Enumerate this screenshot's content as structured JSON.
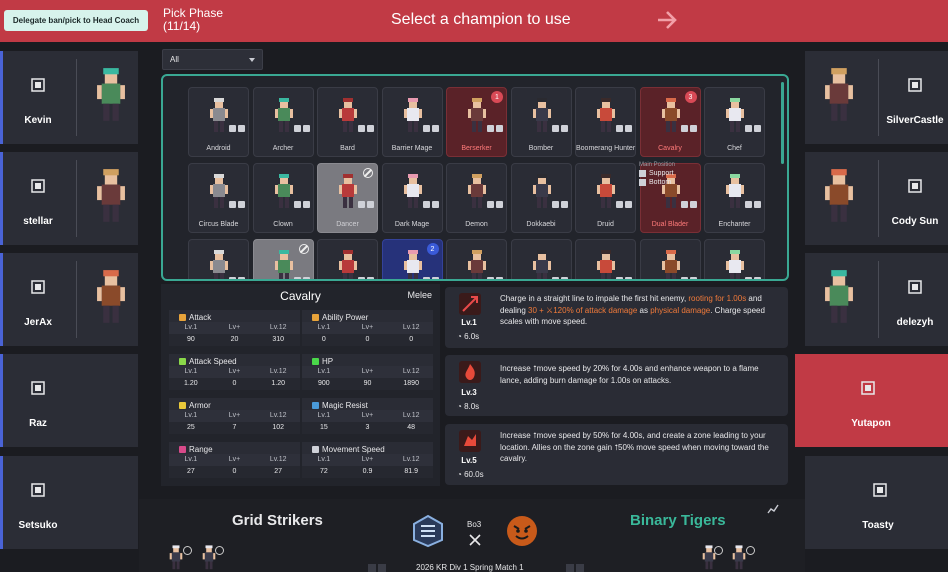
{
  "topbar": {
    "delegate_label": "Delegate ban/pick to Head Coach",
    "phase_title": "Pick Phase",
    "phase_count": "(11/14)",
    "message": "Select a champion to use"
  },
  "left_team": [
    {
      "name": "Kevin",
      "role_icon": "mid-lane-icon"
    },
    {
      "name": "stellar",
      "role_icon": "jungle-icon"
    },
    {
      "name": "JerAx",
      "role_icon": "top-lane-icon"
    },
    {
      "name": "Raz",
      "role_icon": "mid-lane-icon"
    },
    {
      "name": "Setsuko",
      "role_icon": "support-icon"
    }
  ],
  "right_team": [
    {
      "name": "SilverCastle",
      "role_icon": "mid-lane-icon"
    },
    {
      "name": "Cody Sun",
      "role_icon": "jungle-icon"
    },
    {
      "name": "delezyh",
      "role_icon": "top-lane-icon"
    },
    {
      "name": "Yutapon",
      "role_icon": "bottom-lane-icon"
    },
    {
      "name": "Toasty",
      "role_icon": "support-icon"
    }
  ],
  "filter": {
    "selected": "All"
  },
  "champions": [
    {
      "name": "Android",
      "state": "normal"
    },
    {
      "name": "Archer",
      "state": "normal"
    },
    {
      "name": "Bard",
      "state": "normal"
    },
    {
      "name": "Barrier Mage",
      "state": "normal"
    },
    {
      "name": "Berserker",
      "state": "picked",
      "badge": "1"
    },
    {
      "name": "Bomber",
      "state": "normal"
    },
    {
      "name": "Boomerang Hunter",
      "state": "normal"
    },
    {
      "name": "Cavalry",
      "state": "picked",
      "badge": "3"
    },
    {
      "name": "Chef",
      "state": "normal"
    },
    {
      "name": "Circus Blade",
      "state": "normal"
    },
    {
      "name": "Clown",
      "state": "normal"
    },
    {
      "name": "Dancer",
      "state": "banned"
    },
    {
      "name": "Dark Mage",
      "state": "normal"
    },
    {
      "name": "Demon",
      "state": "normal"
    },
    {
      "name": "Dokkaebi",
      "state": "normal"
    },
    {
      "name": "Druid",
      "state": "normal"
    },
    {
      "name": "Dual Blader",
      "state": "picked"
    },
    {
      "name": "Enchanter",
      "state": "normal"
    },
    {
      "name": "",
      "state": "normal"
    },
    {
      "name": "",
      "state": "banned"
    },
    {
      "name": "",
      "state": "normal"
    },
    {
      "name": "",
      "state": "blue-pick",
      "badge": "2"
    },
    {
      "name": "",
      "state": "normal"
    },
    {
      "name": "",
      "state": "normal"
    },
    {
      "name": "",
      "state": "normal"
    },
    {
      "name": "",
      "state": "normal"
    },
    {
      "name": "",
      "state": "normal"
    }
  ],
  "position_popup": {
    "title": "Main Position",
    "options": [
      "Support",
      "Bottom"
    ]
  },
  "stats": {
    "champion": "Cavalry",
    "type": "Melee",
    "col_labels": [
      "Lv.1",
      "Lv+",
      "Lv.12"
    ],
    "items": [
      {
        "name": "Attack",
        "values": [
          "90",
          "20",
          "310"
        ],
        "color": "#e8a33a"
      },
      {
        "name": "Ability Power",
        "values": [
          "0",
          "0",
          "0"
        ],
        "color": "#e8a33a"
      },
      {
        "name": "Attack Speed",
        "values": [
          "1.20",
          "0",
          "1.20"
        ],
        "color": "#8ad84a"
      },
      {
        "name": "HP",
        "values": [
          "900",
          "90",
          "1890"
        ],
        "color": "#4ad84a"
      },
      {
        "name": "Armor",
        "values": [
          "25",
          "7",
          "102"
        ],
        "color": "#e8c83a"
      },
      {
        "name": "Magic Resist",
        "values": [
          "15",
          "3",
          "48"
        ],
        "color": "#4a9ad8"
      },
      {
        "name": "Range",
        "values": [
          "27",
          "0",
          "27"
        ],
        "color": "#d84a8a"
      },
      {
        "name": "Movement Speed",
        "values": [
          "72",
          "0.9",
          "81.9"
        ],
        "color": "#cfd1d8"
      }
    ]
  },
  "skills": [
    {
      "level": "Lv.1",
      "cooldown": "6.0s",
      "parts": [
        "Charge in a straight line to impale the first hit enemy, ",
        "rooting for 1.00s",
        " and dealing ",
        "30 + ⚔120% of attack damage",
        " as ",
        "physical damage",
        ". Charge speed scales with move speed."
      ]
    },
    {
      "level": "Lv.3",
      "cooldown": "8.0s",
      "text": "Increase ⭡move speed by 20% for 4.00s and enhance weapon to a flame lance, adding burn damage for 1.00s on attacks."
    },
    {
      "level": "Lv.5",
      "cooldown": "60.0s",
      "text": "Increase ⭡move speed by 50% for 4.00s, and create a zone leading to your location. Allies on the zone gain ⭡50% move speed when moving toward the cavalry."
    }
  ],
  "match": {
    "left_team_name": "Grid Strikers",
    "right_team_name": "Binary Tigers",
    "format": "Bo3",
    "match_name": "2026 KR Div 1 Spring Match 1"
  },
  "colors": {
    "accent_red": "#c13a45",
    "accent_teal": "#3aa893",
    "blue_side": "#4a63d6",
    "tigers_green": "#3ab89a"
  }
}
